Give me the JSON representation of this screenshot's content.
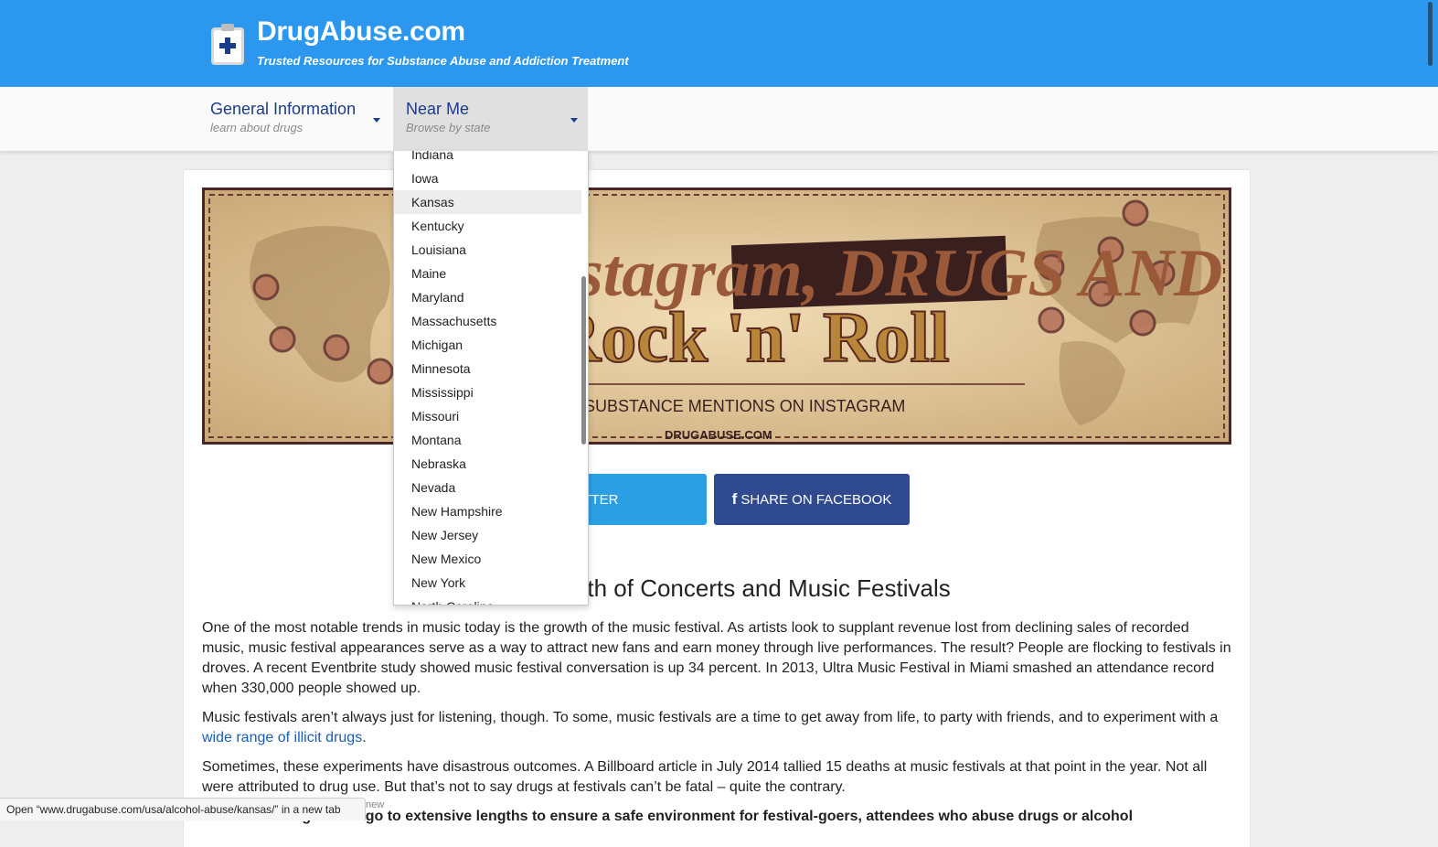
{
  "header": {
    "title": "DrugAbuse.com",
    "tagline": "Trusted Resources for Substance Abuse and Addiction Treatment"
  },
  "nav": {
    "general": {
      "label": "General Information",
      "sub": "learn about drugs"
    },
    "near_me": {
      "label": "Near Me",
      "sub": "Browse by state"
    }
  },
  "dropdown": {
    "options": [
      "Indiana",
      "Iowa",
      "Kansas",
      "Kentucky",
      "Louisiana",
      "Maine",
      "Maryland",
      "Massachusetts",
      "Michigan",
      "Minnesota",
      "Mississippi",
      "Missouri",
      "Montana",
      "Nebraska",
      "Nevada",
      "New Hampshire",
      "New Jersey",
      "New Mexico",
      "New York",
      "North Carolina"
    ],
    "hovered": "Kansas"
  },
  "banner": {
    "headline_1": "Instagram, DRUGS AND",
    "headline_2": "Rock 'n' Roll",
    "subtitle": "FESTIVAL SUBSTANCE MENTIONS ON INSTAGRAM",
    "source": "DRUGABUSE.COM"
  },
  "share": {
    "twitter": "SHARE ON TWITTER",
    "facebook": "SHARE ON FACEBOOK"
  },
  "article": {
    "heading": "The Growth of Concerts and Music Festivals",
    "p1": "One of the most notable trends in music today is the growth of the music festival. As artists look to supplant revenue lost from declining sales of recorded music, music festival appearances serve as a way to attract new fans and earn money through live performances. The result? People are flocking to festivals in droves. A recent Eventbrite study showed music festival conversation is up 34 percent. In 2013, Ultra Music Festival in Miami smashed an attendance record when 330,000 people showed up.",
    "p2_before": "Music festivals aren’t always just for listening, though. To some, music festivals are a time to get away from life, to party with friends, and to experiment with a ",
    "p2_link": "wide range of illicit drugs",
    "p2_after": ".",
    "p3": "Sometimes, these experiments have disastrous outcomes. A Billboard article in July 2014 tallied 15 deaths at music festivals at that point in the year. Not all were attributed to drug use. But that’s not to say drugs at festivals can’t be fatal – quite the contrary.",
    "p4": "While event organizers go to extensive lengths to ensure a safe environment for festival-goers, attendees who abuse drugs or alcohol"
  },
  "statusbar": {
    "text": "Open “www.drugabuse.com/usa/alcohol-abuse/kansas/” in a new tab",
    "ext": "new"
  },
  "colors": {
    "header_bg": "#2b97ee",
    "nav_text": "#1a3c8a",
    "twitter": "#2b9fe4",
    "facebook": "#2f4a8f",
    "link": "#1a5fb4"
  }
}
